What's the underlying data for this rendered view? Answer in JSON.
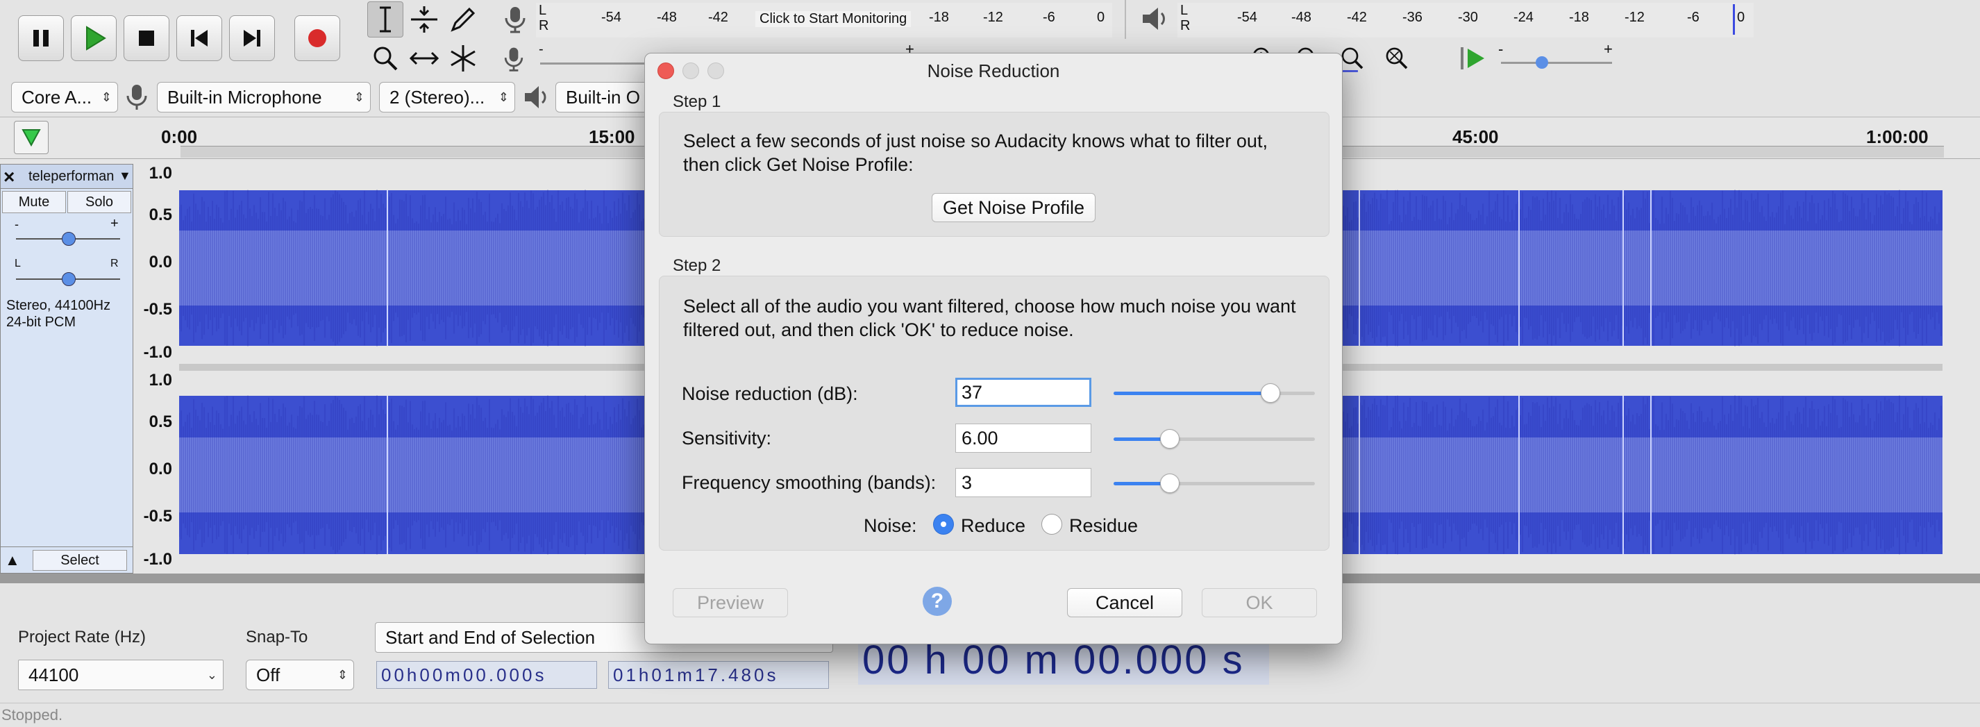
{
  "meters": {
    "record_ticks": [
      "-54",
      "-48",
      "-42",
      "-18",
      "-12",
      "-6",
      "0"
    ],
    "record_prompt": "Click to Start Monitoring",
    "playback_ticks": [
      "-54",
      "-48",
      "-42",
      "-36",
      "-30",
      "-24",
      "-18",
      "-12",
      "-6",
      "0"
    ],
    "lr": [
      "L",
      "R"
    ],
    "slider_minus": "-",
    "slider_plus": "+"
  },
  "devices": {
    "host": "Core A...",
    "input": "Built-in Microphone",
    "channels": "2 (Stereo)...",
    "output": "Built-in O"
  },
  "timeline": {
    "labels": [
      "0:00",
      "15:00",
      "45:00",
      "1:00:00"
    ]
  },
  "track": {
    "name": "teleperforman",
    "mute": "Mute",
    "solo": "Solo",
    "gain_minus": "-",
    "gain_plus": "+",
    "pan_left": "L",
    "pan_right": "R",
    "info_line1": "Stereo, 44100Hz",
    "info_line2": "24-bit PCM",
    "select": "Select",
    "close": "×",
    "ruler": [
      "1.0",
      "0.5",
      "0.0",
      "-0.5",
      "-1.0"
    ]
  },
  "dialog": {
    "title": "Noise Reduction",
    "step1_label": "Step 1",
    "step1_text_line1": "Select a few seconds of just noise so Audacity knows what to filter out,",
    "step1_text_line2": "then click Get Noise Profile:",
    "get_profile": "Get Noise Profile",
    "step2_label": "Step 2",
    "step2_text_line1": "Select all of the audio you want filtered, choose how much noise you want",
    "step2_text_line2": "filtered out, and then click 'OK' to reduce noise.",
    "params": [
      {
        "label": "Noise reduction (dB):",
        "value": "37",
        "level": 0.78
      },
      {
        "label": "Sensitivity:",
        "value": "6.00",
        "level": 0.28
      },
      {
        "label": "Frequency smoothing (bands):",
        "value": "3",
        "level": 0.28
      }
    ],
    "noise_label": "Noise:",
    "noise_options": [
      "Reduce",
      "Residue"
    ],
    "noise_selected": "Reduce",
    "preview": "Preview",
    "help": "?",
    "cancel": "Cancel",
    "ok": "OK"
  },
  "bottom": {
    "project_rate_label": "Project Rate (Hz)",
    "project_rate": "44100",
    "snap_label": "Snap-To",
    "snap_value": "Off",
    "selection_mode": "Start and End of Selection",
    "start_time": "00h00m00.000s",
    "end_time": "01h01m17.480s",
    "position": "00 h 00 m 00.000 s"
  },
  "status": "Stopped.",
  "colors": {
    "waveform": "#3c4fd0",
    "waveform_rms": "#6f7fe0",
    "record": "#d92b2b",
    "play": "#2fa52f",
    "accent": "#3b82f0"
  }
}
